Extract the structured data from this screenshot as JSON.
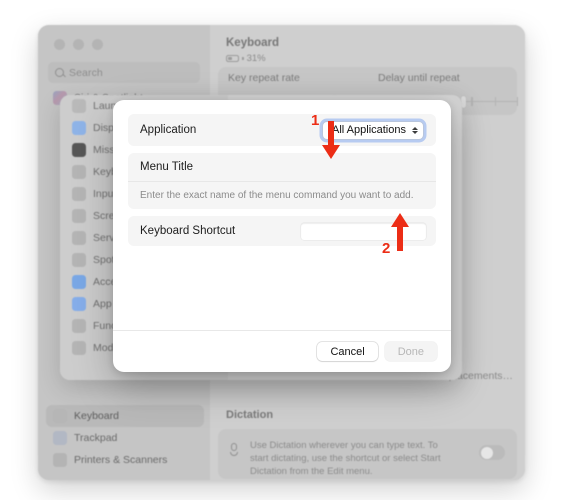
{
  "window": {
    "traffic_lights": [
      "close",
      "minimize",
      "zoom"
    ],
    "search": {
      "placeholder": "Search",
      "icon": "search-icon"
    },
    "sidebar_items": [
      {
        "label": "Siri & Spotlight",
        "icon": "siri-icon",
        "selected": false
      },
      {
        "label": "Keyboard",
        "icon": "keyboard-icon",
        "selected": true
      },
      {
        "label": "Trackpad",
        "icon": "trackpad-icon",
        "selected": false
      },
      {
        "label": "Printers & Scanners",
        "icon": "printer-icon",
        "selected": false
      }
    ],
    "content": {
      "title": "Keyboard",
      "battery_percent": "31%",
      "battery_icon": "battery-icon",
      "key_repeat_rate_label": "Key repeat rate",
      "delay_until_repeat_label": "Delay until repeat",
      "text_replacements_button": "Text Replacements…",
      "dictation_title": "Dictation",
      "dictation_icon": "microphone-icon",
      "dictation_description": "Use Dictation wherever you can type text. To start dictating, use the shortcut or select Start Dictation from the Edit menu.",
      "dictation_toggle": "off"
    }
  },
  "sheet": {
    "categories": [
      {
        "label": "Launchpad",
        "icon": "launchpad-icon"
      },
      {
        "label": "Display",
        "icon": "display-icon"
      },
      {
        "label": "Mission Control",
        "icon": "mission-control-icon"
      },
      {
        "label": "Keyboard",
        "icon": "keyboard-icon"
      },
      {
        "label": "Input Sources",
        "icon": "input-sources-icon"
      },
      {
        "label": "Screenshots",
        "icon": "screenshot-icon"
      },
      {
        "label": "Services",
        "icon": "services-icon"
      },
      {
        "label": "Spotlight",
        "icon": "spotlight-icon"
      },
      {
        "label": "Accessibility",
        "icon": "accessibility-icon"
      },
      {
        "label": "App Shortcuts",
        "icon": "app-shortcuts-icon"
      },
      {
        "label": "Function Keys",
        "icon": "function-keys-icon"
      },
      {
        "label": "Modifier Keys",
        "icon": "modifier-keys-icon"
      }
    ],
    "done_button": "Done"
  },
  "dialog": {
    "application_label": "Application",
    "application_value": "All Applications",
    "application_chevron": "chevron-updown-icon",
    "menu_title_label": "Menu Title",
    "menu_title_value": "",
    "menu_title_hint": "Enter the exact name of the menu command you want to add.",
    "keyboard_shortcut_label": "Keyboard Shortcut",
    "keyboard_shortcut_value": "",
    "cancel_button": "Cancel",
    "done_button": "Done"
  },
  "annotations": {
    "color": "#ec2d16",
    "markers": [
      {
        "number": "1",
        "direction": "down",
        "target": "application-popup-button"
      },
      {
        "number": "2",
        "direction": "up",
        "target": "keyboard-shortcut-input"
      }
    ]
  }
}
